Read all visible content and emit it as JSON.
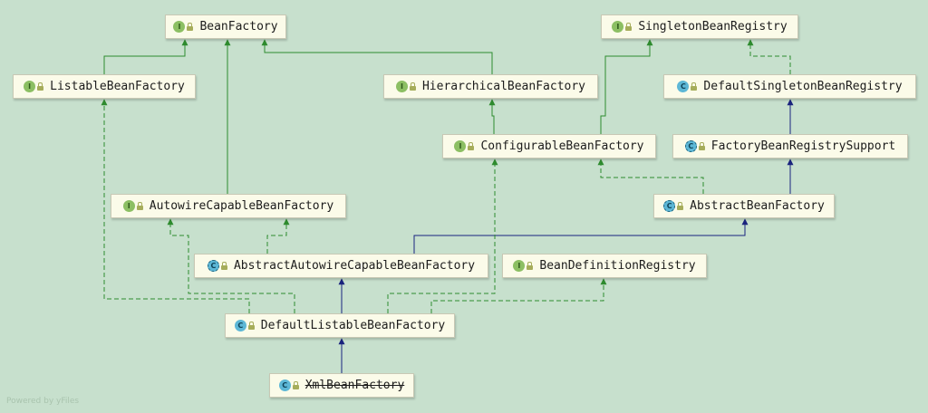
{
  "nodes": {
    "bean_factory": {
      "label": "BeanFactory",
      "kind": "interface"
    },
    "singleton_bean_registry": {
      "label": "SingletonBeanRegistry",
      "kind": "interface"
    },
    "listable_bean_factory": {
      "label": "ListableBeanFactory",
      "kind": "interface"
    },
    "hierarchical_bean_factory": {
      "label": "HierarchicalBeanFactory",
      "kind": "interface"
    },
    "default_singleton_bean_registry": {
      "label": "DefaultSingletonBeanRegistry",
      "kind": "class"
    },
    "configurable_bean_factory": {
      "label": "ConfigurableBeanFactory",
      "kind": "interface"
    },
    "factory_bean_registry_support": {
      "label": "FactoryBeanRegistrySupport",
      "kind": "abstract-class"
    },
    "autowire_capable_bean_factory": {
      "label": "AutowireCapableBeanFactory",
      "kind": "interface"
    },
    "abstract_bean_factory": {
      "label": "AbstractBeanFactory",
      "kind": "abstract-class"
    },
    "abstract_autowire_capable_bean_factory": {
      "label": "AbstractAutowireCapableBeanFactory",
      "kind": "abstract-class"
    },
    "bean_definition_registry": {
      "label": "BeanDefinitionRegistry",
      "kind": "interface"
    },
    "default_listable_bean_factory": {
      "label": "DefaultListableBeanFactory",
      "kind": "class"
    },
    "xml_bean_factory": {
      "label": "XmlBeanFactory",
      "kind": "class",
      "deprecated": true
    }
  },
  "icons": {
    "interface": {
      "glyph": "I",
      "name": "interface-icon"
    },
    "class": {
      "glyph": "C",
      "name": "class-icon"
    },
    "abstract-class": {
      "glyph": "C",
      "name": "abstract-class-icon"
    }
  },
  "edges": [
    {
      "from": "listable_bean_factory",
      "to": "bean_factory",
      "type": "extends"
    },
    {
      "from": "hierarchical_bean_factory",
      "to": "bean_factory",
      "type": "extends"
    },
    {
      "from": "autowire_capable_bean_factory",
      "to": "bean_factory",
      "type": "extends"
    },
    {
      "from": "configurable_bean_factory",
      "to": "hierarchical_bean_factory",
      "type": "extends"
    },
    {
      "from": "configurable_bean_factory",
      "to": "singleton_bean_registry",
      "type": "extends"
    },
    {
      "from": "default_singleton_bean_registry",
      "to": "singleton_bean_registry",
      "type": "implements"
    },
    {
      "from": "factory_bean_registry_support",
      "to": "default_singleton_bean_registry",
      "type": "inherits"
    },
    {
      "from": "abstract_bean_factory",
      "to": "factory_bean_registry_support",
      "type": "inherits"
    },
    {
      "from": "abstract_bean_factory",
      "to": "configurable_bean_factory",
      "type": "implements"
    },
    {
      "from": "abstract_autowire_capable_bean_factory",
      "to": "abstract_bean_factory",
      "type": "inherits"
    },
    {
      "from": "abstract_autowire_capable_bean_factory",
      "to": "autowire_capable_bean_factory",
      "type": "implements"
    },
    {
      "from": "default_listable_bean_factory",
      "to": "abstract_autowire_capable_bean_factory",
      "type": "inherits"
    },
    {
      "from": "default_listable_bean_factory",
      "to": "listable_bean_factory",
      "type": "implements"
    },
    {
      "from": "default_listable_bean_factory",
      "to": "autowire_capable_bean_factory",
      "type": "implements"
    },
    {
      "from": "default_listable_bean_factory",
      "to": "configurable_bean_factory",
      "type": "implements"
    },
    {
      "from": "default_listable_bean_factory",
      "to": "bean_definition_registry",
      "type": "implements"
    },
    {
      "from": "xml_bean_factory",
      "to": "default_listable_bean_factory",
      "type": "inherits"
    }
  ],
  "colors": {
    "background": "#c7e0cd",
    "interface_edge": "#2e8b2e",
    "class_edge": "#1a237e"
  },
  "watermark": "Powered by yFiles"
}
